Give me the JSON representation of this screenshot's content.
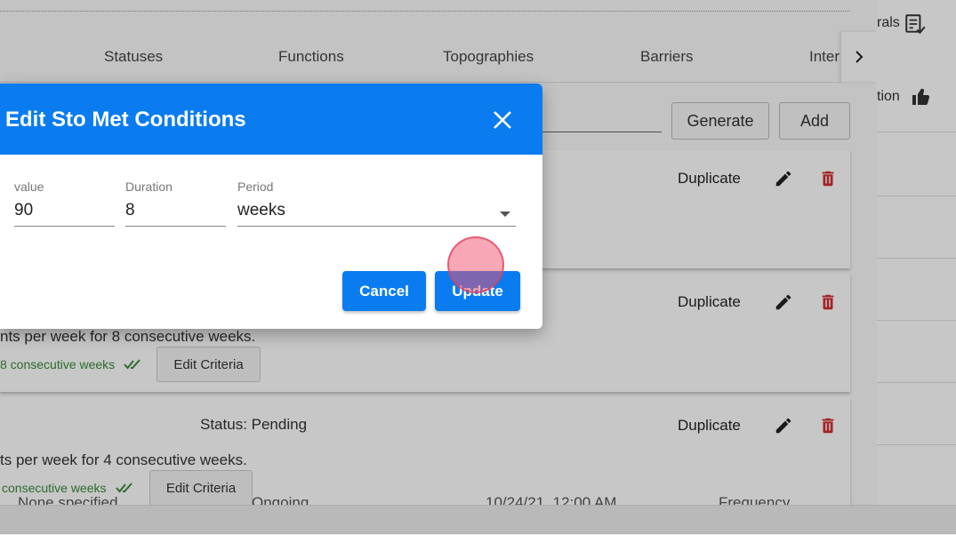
{
  "tabs": [
    "Statuses",
    "Functions",
    "Topographies",
    "Barriers",
    "Inter"
  ],
  "toolbar": {
    "generate_label": "Generate",
    "add_label": "Add"
  },
  "cards": [
    {
      "duplicate_label": "Duplicate"
    },
    {
      "duplicate_label": "Duplicate",
      "text": "nts per week for 8 consecutive weeks.",
      "met_text": "8 consecutive weeks",
      "edit_label": "Edit Criteria"
    },
    {
      "duplicate_label": "Duplicate",
      "status": "Status: Pending",
      "text": "ts per week for 4 consecutive weeks.",
      "met_text": "consecutive weeks",
      "edit_label": "Edit Criteria"
    }
  ],
  "behind_row": [
    "None specified",
    "Ongoing",
    "10/24/21, 12:00 AM",
    "Frequency"
  ],
  "right_panel": {
    "item1": "rals",
    "item2": "tion"
  },
  "modal": {
    "title": "Edit Sto Met Conditions",
    "fields": {
      "value": {
        "label": "value",
        "value": "90"
      },
      "duration": {
        "label": "Duration",
        "value": "8"
      },
      "period": {
        "label": "Period",
        "value": "weeks"
      }
    },
    "cancel_label": "Cancel",
    "update_label": "Update"
  },
  "colors": {
    "primary": "#0a7cf0",
    "delete": "#d32f2f",
    "success": "#3a8a3a"
  }
}
